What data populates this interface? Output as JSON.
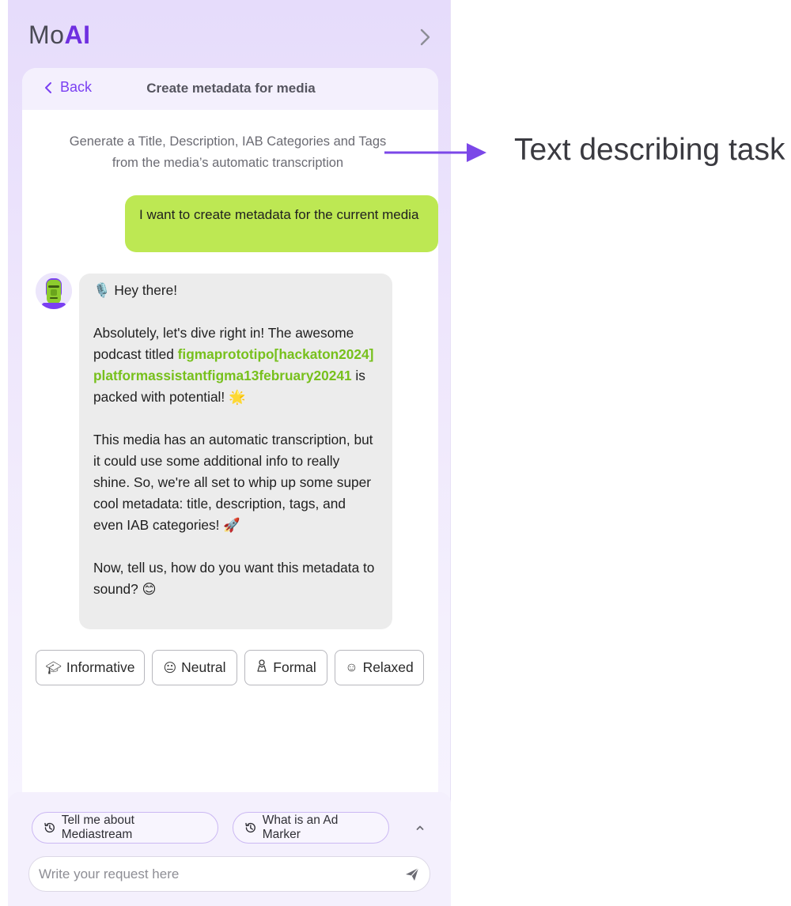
{
  "app": {
    "logo_mo": "Mo",
    "logo_ai": "AI"
  },
  "header": {
    "back_label": "Back",
    "title": "Create metadata for media"
  },
  "task": {
    "description": "Generate a Title, Description, IAB Categories and Tags from the media’s automatic transcription"
  },
  "conversation": {
    "user_message": "I want to create metadata for the current media",
    "bot": {
      "greeting_emoji": "🎙️",
      "greeting": "Hey there!",
      "para1_before": "Absolutely, let's dive right in! The awesome podcast titled",
      "media_title": "figmaprototipo[hackaton2024]platformassistantfigma13february20241",
      "para1_after": "is packed with potential!",
      "para1_emoji": "🌟",
      "para2": "This media has an automatic transcription, but it could use some additional info to really shine. So, we're all set to whip up some super cool metadata: title, description, tags, and even IAB categories!",
      "para2_emoji": "🚀",
      "para3": "Now, tell us, how do you want this metadata to sound?",
      "para3_emoji": "😊"
    }
  },
  "tone_options": [
    {
      "label": "Informative",
      "icon": "graduation-cap-icon"
    },
    {
      "label": "Neutral",
      "icon": "neutral-face-icon"
    },
    {
      "label": "Formal",
      "icon": "tie-icon"
    },
    {
      "label": "Relaxed",
      "icon": "smile-icon"
    }
  ],
  "quick_prompts": [
    {
      "label": "Tell me about Mediastream",
      "icon": "history-icon"
    },
    {
      "label": "What is an Ad Marker",
      "icon": "history-icon"
    }
  ],
  "input": {
    "placeholder": "Write your request here",
    "value": ""
  },
  "annotation": {
    "text": "Text describing task"
  },
  "colors": {
    "accent": "#6f2fe0",
    "user_bubble": "#bde853",
    "highlight": "#77c01c",
    "bot_bubble": "#ececec"
  }
}
